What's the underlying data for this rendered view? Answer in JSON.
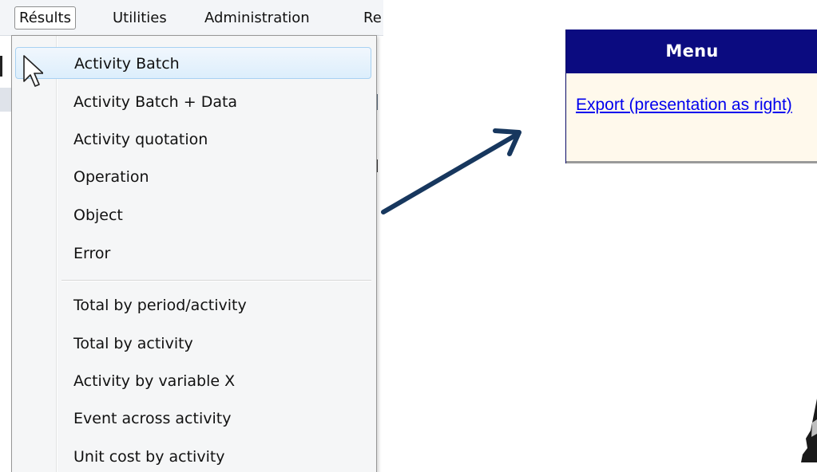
{
  "menubar": {
    "items": [
      {
        "label": "Résults",
        "active": true
      },
      {
        "label": "Utilities",
        "active": false
      },
      {
        "label": "Administration",
        "active": false
      },
      {
        "label": "Re",
        "active": false
      }
    ]
  },
  "dropdown": {
    "group1": [
      {
        "label": "Activity Batch",
        "highlighted": true
      },
      {
        "label": "Activity Batch + Data",
        "highlighted": false
      },
      {
        "label": "Activity quotation",
        "highlighted": false
      },
      {
        "label": "Operation",
        "highlighted": false
      },
      {
        "label": "Object",
        "highlighted": false
      },
      {
        "label": "Error",
        "highlighted": false
      }
    ],
    "group2": [
      {
        "label": "Total by period/activity"
      },
      {
        "label": "Total by activity"
      },
      {
        "label": "Activity by variable X"
      },
      {
        "label": "Event across activity"
      },
      {
        "label": "Unit cost by activity"
      }
    ]
  },
  "icons": {
    "cursor": "pointer-cursor-icon",
    "arrow": "diagonal-arrow-icon"
  },
  "menu_panel": {
    "title": "Menu",
    "export_link": "Export (presentation as right)"
  },
  "colors": {
    "panel_header": "#0b0b80",
    "panel_bg": "#fff9ec",
    "link": "#0000ee",
    "arrow": "#17375e",
    "highlight_border": "#a8d1f2"
  }
}
